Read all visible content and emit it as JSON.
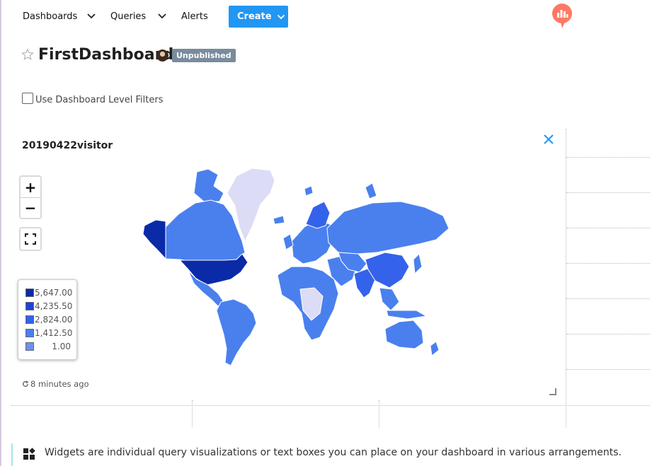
{
  "nav": {
    "items": [
      {
        "label": "Dashboards",
        "has_dropdown": true
      },
      {
        "label": "Queries",
        "has_dropdown": true
      },
      {
        "label": "Alerts",
        "has_dropdown": false
      }
    ],
    "create_label": "Create",
    "logo_icon": "redash-logo-icon"
  },
  "dashboard": {
    "title": "FirstDashboard",
    "status_badge": "Unpublished",
    "favorite_icon": "star-outline-icon"
  },
  "filters": {
    "label": "Use Dashboard Level Filters",
    "checked": false
  },
  "widget": {
    "title": "20190422visitor",
    "zoom_in_label": "+",
    "zoom_out_label": "−",
    "legend": [
      {
        "value": "5,647.00",
        "color": "#0b2aa8"
      },
      {
        "value": "4,235.50",
        "color": "#1d44d6"
      },
      {
        "value": "2,824.00",
        "color": "#3462ea"
      },
      {
        "value": "1,412.50",
        "color": "#4a80ee"
      },
      {
        "value": "1.00",
        "color": "#6b92ee"
      }
    ],
    "updated": "8 minutes ago",
    "no_data_color": "#dcdcf6"
  },
  "info": {
    "text": "Widgets are individual query visualizations or text boxes you can place on your dashboard in various arrangements."
  },
  "colors": {
    "accent": "#2196f3",
    "badge": "#7a8b9c"
  }
}
